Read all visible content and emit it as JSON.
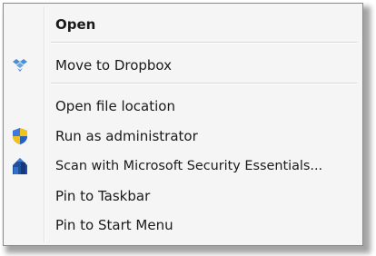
{
  "context_menu": {
    "items": [
      {
        "label": "Open",
        "icon": null,
        "bold": true
      },
      {
        "label": "Move to Dropbox",
        "icon": "dropbox-icon",
        "bold": false
      },
      {
        "label": "Open file location",
        "icon": null,
        "bold": false
      },
      {
        "label": "Run as administrator",
        "icon": "uac-shield-icon",
        "bold": false
      },
      {
        "label": "Scan with Microsoft Security Essentials...",
        "icon": "security-essentials-icon",
        "bold": false
      },
      {
        "label": "Pin to Taskbar",
        "icon": null,
        "bold": false
      },
      {
        "label": "Pin to Start Menu",
        "icon": null,
        "bold": false
      }
    ],
    "colors": {
      "menu_background": "#f5f5f5",
      "border": "#8a8a8a",
      "text": "#1a1a1a",
      "dropbox_blue": "#4a8fd6",
      "shield_blue": "#2b5fb8",
      "shield_yellow": "#f2c21b"
    }
  }
}
